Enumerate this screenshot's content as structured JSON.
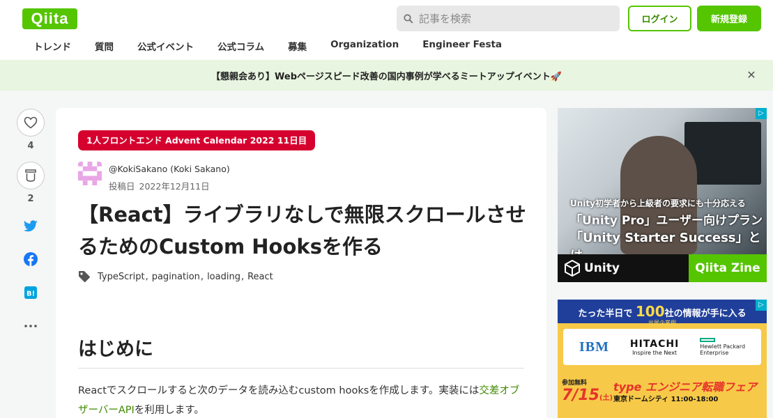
{
  "header": {
    "logo": "Qiita",
    "search_placeholder": "記事を検索",
    "login_label": "ログイン",
    "signup_label": "新規登録",
    "nav": [
      "トレンド",
      "質問",
      "公式イベント",
      "公式コラム",
      "募集",
      "Organization",
      "Engineer Festa"
    ]
  },
  "banner": {
    "text": "【懇親会あり】Webページスピード改善の国内事例が学べるミートアップイベント🚀",
    "close": "✕"
  },
  "rail": {
    "like_count": "4",
    "stock_count": "2"
  },
  "article": {
    "advent_badge": "1人フロントエンド Advent Calendar 2022 11日目",
    "author": "@KokiSakano (Koki Sakano)",
    "posted_label": "投稿日",
    "posted_date": "2022年12月11日",
    "title": "【React】ライブラリなしで無限スクロールさせるためのCustom Hooksを作る",
    "tags": [
      "TypeScript",
      "pagination",
      "loading",
      "React"
    ],
    "h2": "はじめに",
    "para_before": "Reactでスクロールすると次のデータを読み込むcustom hooksを作成します。実装には",
    "para_link": "交差オブザーバーAPI",
    "para_after": "を利用します。"
  },
  "ad1": {
    "line1": "Unity初学者から上級者の要求にも十分応える",
    "line2": "「Unity Pro」ユーザー向けプラン",
    "line3": "「Unity Starter Success」とは",
    "brand": "Unity",
    "zine": "Qiita Zine"
  },
  "ad2": {
    "headline_pre": "たった半日で",
    "headline_num": "100",
    "headline_post": "社の情報が手に入る",
    "sub": "出展企業例",
    "ibm": "IBM",
    "hitachi": "HITACHI",
    "hitachi_tag": "Inspire the Next",
    "hpe1": "Hewlett Packard",
    "hpe2": "Enterprise",
    "date_label": "参加無料",
    "date": "7/15",
    "date_day": "(土)",
    "fair": "type エンジニア転職フェア",
    "venue": "東京ドームシティ 11:00-18:00"
  },
  "colors": {
    "brand_green": "#55c500",
    "advent_red": "#d6002f",
    "link_green": "#3f8a00"
  }
}
